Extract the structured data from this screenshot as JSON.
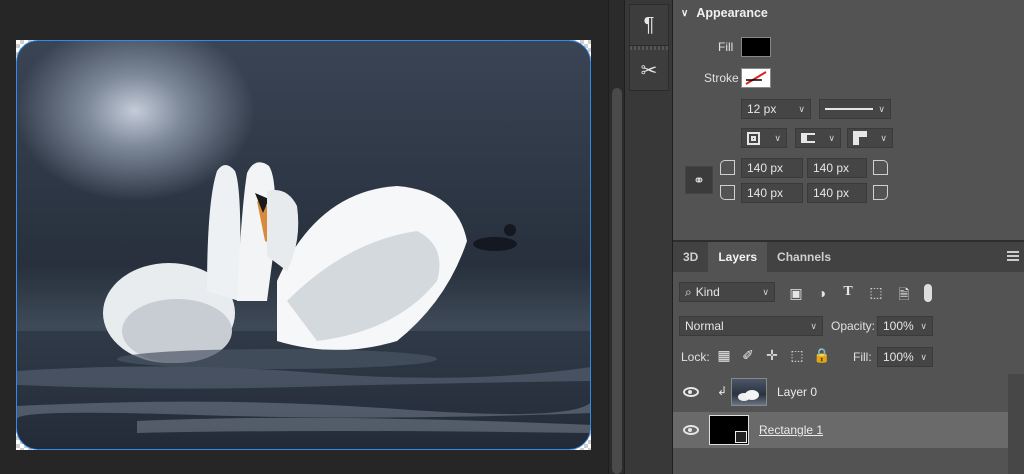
{
  "tools": {
    "paragraph_icon": "¶",
    "scissors_icon": "✂"
  },
  "appearance": {
    "title": "Appearance",
    "fill_label": "Fill",
    "stroke_label": "Stroke",
    "stroke_size": "12 px",
    "fill_color": "#000000",
    "corner_tl": "140 px",
    "corner_tr": "140 px",
    "corner_bl": "140 px",
    "corner_br": "140 px"
  },
  "layers_panel": {
    "tabs": [
      "3D",
      "Layers",
      "Channels"
    ],
    "active_tab": "Layers",
    "filter_kind": "Kind",
    "blend_mode": "Normal",
    "opacity_label": "Opacity:",
    "opacity_value": "100%",
    "lock_label": "Lock:",
    "fill_label": "Fill:",
    "fill_value": "100%",
    "layers": [
      {
        "name": "Layer 0",
        "visible": true,
        "clipped": true,
        "selected": false
      },
      {
        "name": "Rectangle 1",
        "visible": true,
        "clipped": false,
        "selected": true
      }
    ]
  },
  "colors": {
    "selection_outline": "#2d8ceb",
    "panel_bg": "#535353",
    "selected_layer": "#6a6a6a"
  }
}
